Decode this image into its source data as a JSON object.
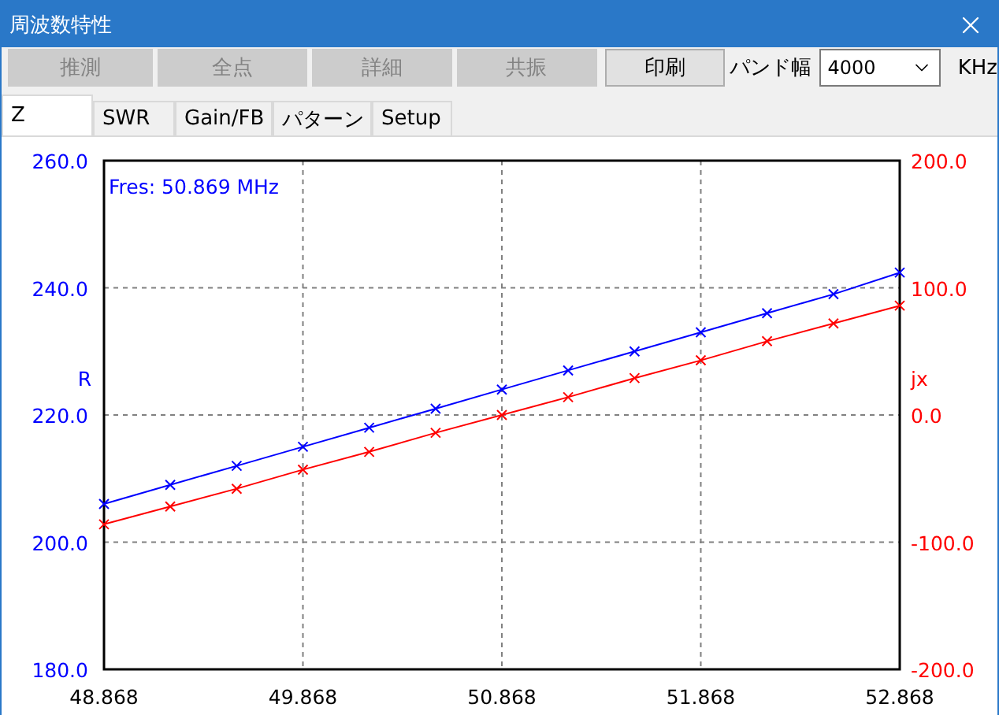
{
  "window": {
    "title": "周波数特性"
  },
  "toolbar": {
    "buttons": [
      {
        "label": "推測",
        "disabled": true
      },
      {
        "label": "全点",
        "disabled": true
      },
      {
        "label": "詳細",
        "disabled": true
      },
      {
        "label": "共振",
        "disabled": true
      },
      {
        "label": "印刷",
        "disabled": false
      }
    ],
    "bandwidth_label": "パンド幅",
    "bandwidth_value": "4000",
    "unit": "KHz"
  },
  "tabs": [
    {
      "label": "Z",
      "selected": true
    },
    {
      "label": "SWR",
      "selected": false
    },
    {
      "label": "Gain/FB",
      "selected": false
    },
    {
      "label": "パターン",
      "selected": false
    },
    {
      "label": "Setup",
      "selected": false
    }
  ],
  "annotation": "Fres: 50.869 MHz",
  "chart_data": {
    "type": "line",
    "grid": true,
    "x": [
      48.868,
      49.201,
      49.535,
      49.868,
      50.201,
      50.535,
      50.868,
      51.201,
      51.535,
      51.868,
      52.201,
      52.535,
      52.868
    ],
    "xlim": [
      48.868,
      52.868
    ],
    "xticks": [
      {
        "value": 48.868,
        "label": "48.868"
      },
      {
        "value": 49.868,
        "label": "49.868"
      },
      {
        "value": 50.868,
        "label": "50.868"
      },
      {
        "value": 51.868,
        "label": "51.868"
      },
      {
        "value": 52.868,
        "label": "52.868"
      }
    ],
    "ylim": [
      180,
      260
    ],
    "yticks": [
      {
        "value": 180,
        "label": "180.0"
      },
      {
        "value": 200,
        "label": "200.0"
      },
      {
        "value": 220,
        "label": "220.0"
      },
      {
        "value": 240,
        "label": "240.0"
      },
      {
        "value": 260,
        "label": "260.0"
      }
    ],
    "y2lim": [
      -200,
      200
    ],
    "y2ticks": [
      {
        "value": -200,
        "label": "-200.0"
      },
      {
        "value": -100,
        "label": "-100.0"
      },
      {
        "value": 0,
        "label": "0.0"
      },
      {
        "value": 100,
        "label": "100.0"
      },
      {
        "value": 200,
        "label": "200.0"
      }
    ],
    "series": [
      {
        "name": "R",
        "color": "#0000ff",
        "marker": "x",
        "values": [
          206.0,
          209.0,
          212.0,
          215.0,
          218.0,
          221.0,
          224.0,
          227.0,
          230.0,
          233.0,
          236.0,
          239.0,
          242.4
        ]
      },
      {
        "name": "jx",
        "color": "#ff0000",
        "axis": "y2",
        "marker": "x",
        "values": [
          -86,
          -72,
          -58,
          -43,
          -29,
          -14,
          0,
          14,
          29,
          43,
          58,
          72,
          86
        ]
      }
    ]
  }
}
